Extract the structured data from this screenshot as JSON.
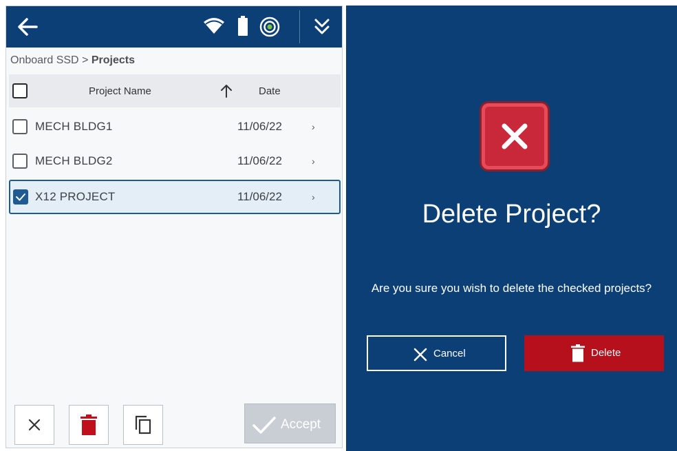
{
  "left_screen": {
    "breadcrumb": {
      "path": "Onboard SSD",
      "separator": ">",
      "current": "Projects"
    },
    "table_header": {
      "name_label": "Project Name",
      "date_label": "Date",
      "sort_icon": "arrow-up-icon"
    },
    "projects": [
      {
        "name": "MECH BLDG1",
        "date": "11/06/22",
        "checked": false
      },
      {
        "name": "MECH BLDG2",
        "date": "11/06/22",
        "checked": false
      },
      {
        "name": "X12 PROJECT",
        "date": "11/06/22",
        "checked": true
      }
    ],
    "chevron": "›",
    "footer": {
      "accept_label": "Accept",
      "accept_enabled": false
    },
    "status_icons": [
      "wifi-icon",
      "battery-icon",
      "gps-icon"
    ]
  },
  "dialog": {
    "title": "Delete Project?",
    "message": "Are you sure you wish to delete the checked projects?",
    "cancel_label": "Cancel",
    "delete_label": "Delete"
  },
  "colors": {
    "brand_blue": "#0b3f75",
    "danger_red": "#b5101c",
    "selected_border": "#1f5a93"
  }
}
